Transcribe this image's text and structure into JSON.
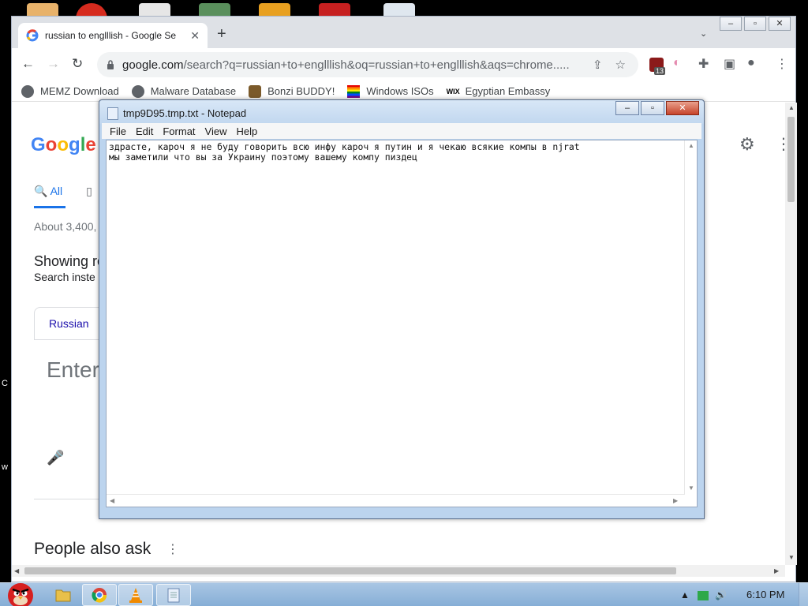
{
  "chrome": {
    "tab_title": "russian to englllish - Google Se",
    "url_host": "google.com",
    "url_path": "/search?q=russian+to+englllish&oq=russian+to+englllish&aqs=chrome.....",
    "ext_badge_count": "13",
    "bookmarks": [
      {
        "label": "MEMZ Download",
        "icon": "globe-icon"
      },
      {
        "label": "Malware Database",
        "icon": "globe-icon"
      },
      {
        "label": "Bonzi BUDDY!",
        "icon": "bonzi-icon"
      },
      {
        "label": "Windows ISOs",
        "icon": "windows-flag-icon"
      },
      {
        "label": "Egyptian Embassy",
        "icon": "wix-icon"
      }
    ]
  },
  "google": {
    "tab_all": "All",
    "about": "About 3,400,",
    "showing": "Showing re",
    "instead": "Search inste",
    "language": "Russian",
    "enter_placeholder": "Enter",
    "people_also_ask": "People also ask"
  },
  "notepad": {
    "title": "tmp9D95.tmp.txt - Notepad",
    "menu": [
      "File",
      "Edit",
      "Format",
      "View",
      "Help"
    ],
    "lines": [
      "здрасте, кароч я не буду говорить всю инфу кароч я путин и я чекаю всякие компы в njrat",
      "мы заметили что вы за Украину поэтому вашему компу пиздец"
    ]
  },
  "taskbar": {
    "clock": "6:10 PM"
  },
  "desktop": {
    "side_text_1": "C",
    "side_text_2": "w"
  }
}
